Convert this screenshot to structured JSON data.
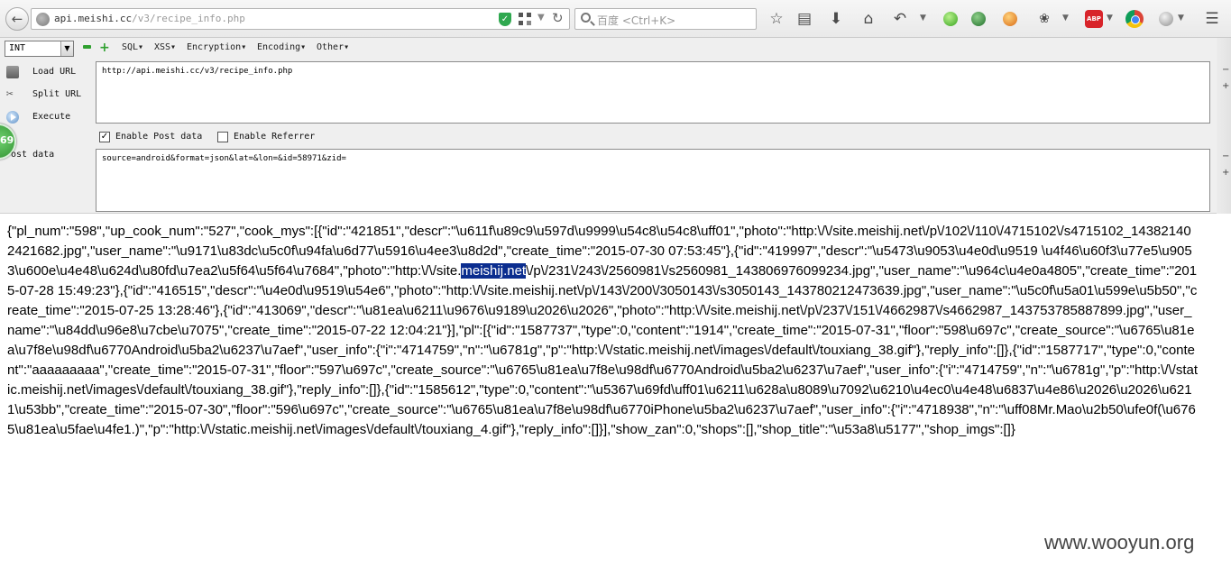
{
  "browser": {
    "url": {
      "host": "api.meishi.cc",
      "path": "/v3/recipe_info.php"
    },
    "search_placeholder": "百度 <Ctrl+K>"
  },
  "hackbar": {
    "type_select": "INT",
    "menu": [
      "SQL▾",
      "XSS▾",
      "Encryption▾",
      "Encoding▾",
      "Other▾"
    ],
    "side_buttons": {
      "load": "Load URL",
      "split": "Split URL",
      "execute": "Execute"
    },
    "badge_count": "69",
    "url_value": "http://api.meishi.cc/v3/recipe_info.php",
    "enable_post_label": "Enable Post data",
    "enable_post_checked": true,
    "enable_referrer_label": "Enable Referrer",
    "enable_referrer_checked": false,
    "post_label": "ost data",
    "post_value": "source=android&format=json&lat=&lon=&id=58971&zid="
  },
  "response": {
    "before_highlight": "{\"pl_num\":\"598\",\"up_cook_num\":\"527\",\"cook_mys\":[{\"id\":\"421851\",\"descr\":\"\\u611f\\u89c9\\u597d\\u9999\\u54c8\\u54c8\\uff01\",\"photo\":\"http:\\/\\/site.meishij.net\\/p\\/102\\/110\\/4715102\\/s4715102_143821402421682.jpg\",\"user_name\":\"\\u9171\\u83dc\\u5c0f\\u94fa\\u6d77\\u5916\\u4ee3\\u8d2d\",\"create_time\":\"2015-07-30 07:53:45\"},{\"id\":\"419997\",\"descr\":\"\\u5473\\u9053\\u4e0d\\u9519 \\u4f46\\u60f3\\u77e5\\u9053\\u600e\\u4e48\\u624d\\u80fd\\u7ea2\\u5f64\\u5f64\\u7684\",\"photo\":\"http:\\/\\/site.",
    "highlight": "meishij.net",
    "after_highlight": "\\/p\\/231\\/243\\/2560981\\/s2560981_143806976099234.jpg\",\"user_name\":\"\\u964c\\u4e0a4805\",\"create_time\":\"2015-07-28 15:49:23\"},{\"id\":\"416515\",\"descr\":\"\\u4e0d\\u9519\\u54e6\",\"photo\":\"http:\\/\\/site.meishij.net\\/p\\/143\\/200\\/3050143\\/s3050143_143780212473639.jpg\",\"user_name\":\"\\u5c0f\\u5a01\\u599e\\u5b50\",\"create_time\":\"2015-07-25 13:28:46\"},{\"id\":\"413069\",\"descr\":\"\\u81ea\\u6211\\u9676\\u9189\\u2026\\u2026\",\"photo\":\"http:\\/\\/site.meishij.net\\/p\\/237\\/151\\/4662987\\/s4662987_143753785887899.jpg\",\"user_name\":\"\\u84dd\\u96e8\\u7cbe\\u7075\",\"create_time\":\"2015-07-22 12:04:21\"}],\"pl\":[{\"id\":\"1587737\",\"type\":0,\"content\":\"1914\",\"create_time\":\"2015-07-31\",\"floor\":\"598\\u697c\",\"create_source\":\"\\u6765\\u81ea\\u7f8e\\u98df\\u6770Android\\u5ba2\\u6237\\u7aef\",\"user_info\":{\"i\":\"4714759\",\"n\":\"\\u6781g\",\"p\":\"http:\\/\\/static.meishij.net\\/images\\/default\\/touxiang_38.gif\"},\"reply_info\":[]},{\"id\":\"1587717\",\"type\":0,\"content\":\"aaaaaaaaa\",\"create_time\":\"2015-07-31\",\"floor\":\"597\\u697c\",\"create_source\":\"\\u6765\\u81ea\\u7f8e\\u98df\\u6770Android\\u5ba2\\u6237\\u7aef\",\"user_info\":{\"i\":\"4714759\",\"n\":\"\\u6781g\",\"p\":\"http:\\/\\/static.meishij.net\\/images\\/default\\/touxiang_38.gif\"},\"reply_info\":[]},{\"id\":\"1585612\",\"type\":0,\"content\":\"\\u5367\\u69fd\\uff01\\u6211\\u628a\\u8089\\u7092\\u6210\\u4ec0\\u4e48\\u6837\\u4e86\\u2026\\u2026\\u6211\\u53bb\",\"create_time\":\"2015-07-30\",\"floor\":\"596\\u697c\",\"create_source\":\"\\u6765\\u81ea\\u7f8e\\u98df\\u6770iPhone\\u5ba2\\u6237\\u7aef\",\"user_info\":{\"i\":\"4718938\",\"n\":\"\\uff08Mr.Mao\\u2b50\\ufe0f(\\u6765\\u81ea\\u5fae\\u4fe1.)\",\"p\":\"http:\\/\\/static.meishij.net\\/images\\/default\\/touxiang_4.gif\"},\"reply_info\":[]}],\"show_zan\":0,\"shops\":[],\"shop_title\":\"\\u53a8\\u5177\",\"shop_imgs\":[]}"
  },
  "watermark": "www.wooyun.org",
  "icons": {
    "back": "back-arrow-icon",
    "bookmark_star": "star-icon",
    "reading_list": "reading-list-icon",
    "download": "download-icon",
    "home": "home-icon",
    "undo": "undo-icon",
    "menu": "hamburger-menu-icon"
  },
  "colors": {
    "accent_green": "#2fa02f",
    "highlight_bg": "#0b2d8f",
    "abp_red": "#d8242a"
  }
}
